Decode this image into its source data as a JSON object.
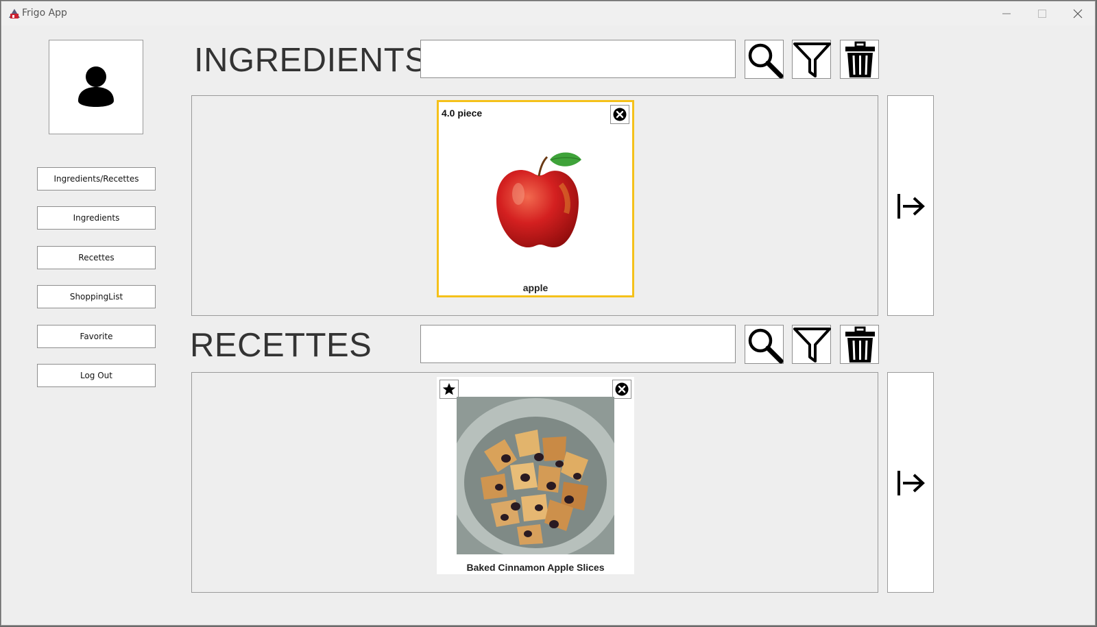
{
  "window": {
    "title": "Frigo App"
  },
  "sidebar": {
    "avatar_icon": "user-icon",
    "items": [
      {
        "label": "Ingredients/Recettes"
      },
      {
        "label": "Ingredients"
      },
      {
        "label": "Recettes"
      },
      {
        "label": "ShoppingList"
      },
      {
        "label": "Favorite"
      },
      {
        "label": "Log Out"
      }
    ]
  },
  "ingredients": {
    "title": "INGREDIENTS",
    "search_value": "",
    "toolbar_icons": [
      "search-icon",
      "filter-icon",
      "trash-icon"
    ],
    "next_icon": "arrow-right-bar-icon",
    "cards": [
      {
        "quantity": "4.0 piece",
        "name": "apple",
        "image": "apple",
        "selected": true
      }
    ]
  },
  "recettes": {
    "title": "RECETTES",
    "search_value": "",
    "toolbar_icons": [
      "search-icon",
      "filter-icon",
      "trash-icon"
    ],
    "next_icon": "arrow-right-bar-icon",
    "cards": [
      {
        "name": "Baked Cinnamon Apple Slices",
        "image": "baked-apple-slices",
        "favorite_icon": "star-icon"
      }
    ]
  },
  "colors": {
    "selected_border": "#f5c11a",
    "background": "#eeeeee"
  }
}
